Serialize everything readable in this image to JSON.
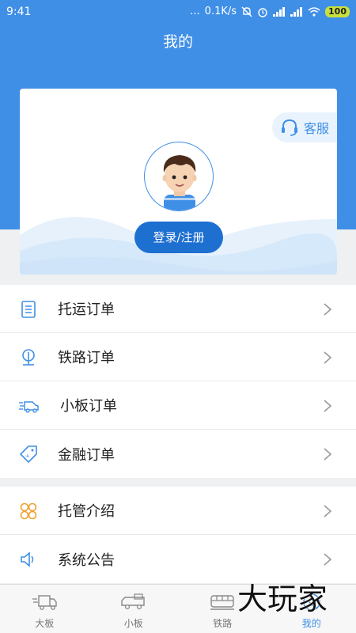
{
  "status_bar": {
    "time": "9:41",
    "dots": "...",
    "network_speed": "0.1K/s",
    "battery": "100"
  },
  "header": {
    "title": "我的"
  },
  "profile_card": {
    "customer_service_label": "客服",
    "login_button_label": "登录/注册"
  },
  "menu_group_1": [
    {
      "label": "托运订单",
      "icon": "clipboard-icon"
    },
    {
      "label": "铁路订单",
      "icon": "rail-icon"
    },
    {
      "label": "小板订单",
      "icon": "small-truck-icon"
    },
    {
      "label": "金融订单",
      "icon": "finance-tag-icon"
    }
  ],
  "menu_group_2": [
    {
      "label": "托管介绍",
      "icon": "grid-icon"
    },
    {
      "label": "系统公告",
      "icon": "speaker-icon"
    }
  ],
  "tabbar": {
    "tabs": [
      {
        "label": "大板",
        "icon": "big-truck-icon"
      },
      {
        "label": "小板",
        "icon": "small-truck-icon"
      },
      {
        "label": "铁路",
        "icon": "train-icon"
      },
      {
        "label": "我的",
        "icon": "profile-icon",
        "active": true
      }
    ]
  },
  "watermark": {
    "text": "大玩家"
  },
  "colors": {
    "primary": "#3f8fe6",
    "login_button": "#1d6fd0",
    "orange_icon": "#f0a030"
  }
}
